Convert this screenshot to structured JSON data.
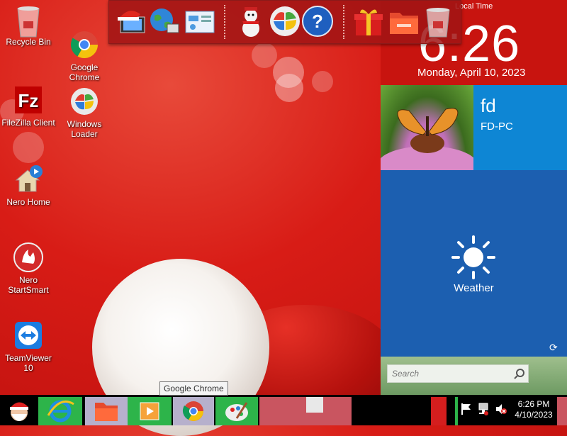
{
  "desktop": {
    "icons": [
      {
        "label": "Recycle Bin"
      },
      {
        "label": "Google\nChrome"
      },
      {
        "label": "FileZilla Client"
      },
      {
        "label": "Windows\nLoader"
      },
      {
        "label": "Nero Home"
      },
      {
        "label": "Nero\nStartSmart"
      },
      {
        "label": "TeamViewer\n10"
      }
    ]
  },
  "clock_widget": {
    "label": "Local Time",
    "time": "6:26",
    "date": "Monday, April 10, 2023"
  },
  "tiles": {
    "user": {
      "name": "fd",
      "pc": "FD-PC"
    },
    "weather": {
      "label": "Weather",
      "refresh_icon": "refresh-icon"
    }
  },
  "search": {
    "placeholder": "Search"
  },
  "dock": {
    "items": [
      "santa-hat-computer-icon",
      "globe-network-icon",
      "control-panel-icon",
      "snowman-icon",
      "windows-logo-icon",
      "help-icon",
      "gift-icon",
      "folder-icon",
      "recycle-bin-icon"
    ]
  },
  "taskbar": {
    "tooltip": "Google Chrome",
    "tray_time": "6:26 PM",
    "tray_date": "4/10/2023"
  }
}
